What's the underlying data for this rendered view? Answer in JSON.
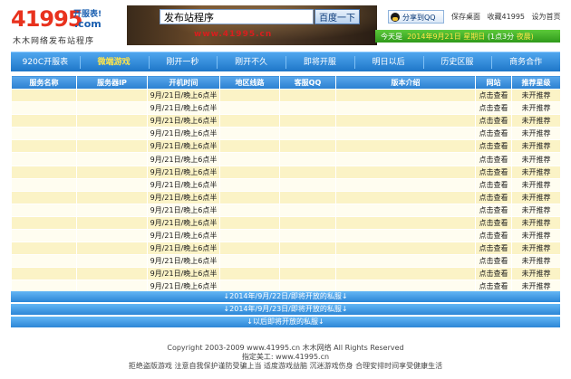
{
  "logo": {
    "number": "41995",
    "domain": ".com",
    "badge": "开服表!",
    "subtitle": "木木网络发布站程序"
  },
  "search": {
    "value": "发布站程序",
    "button": "百度一下",
    "banner_url": "www.41995.cn"
  },
  "top_bar": {
    "share_label": "分享到QQ",
    "links": [
      "保存桌面",
      "收藏41995",
      "设为首页"
    ]
  },
  "date_bar": {
    "prefix": "今天是",
    "date": "2014年9月21日",
    "weekday": "星期日",
    "lunar": "(1点3分",
    "status": "夜晨)"
  },
  "nav": {
    "tabs": [
      {
        "label": "920C开服表",
        "active": false
      },
      {
        "label": "微端游戏",
        "active": true
      },
      {
        "label": "刚开一秒",
        "active": false
      },
      {
        "label": "刚开不久",
        "active": false
      },
      {
        "label": "即将开服",
        "active": false
      },
      {
        "label": "明日以后",
        "active": false
      },
      {
        "label": "历史区服",
        "active": false
      },
      {
        "label": "商务合作",
        "active": false
      }
    ]
  },
  "table": {
    "headers": [
      "服务名称",
      "服务器IP",
      "开机时间",
      "地区线路",
      "客服QQ",
      "版本介绍",
      "网站",
      "推荐星级"
    ],
    "rows": [
      {
        "name": "",
        "ip": "",
        "time": "9月/21日/晚上6点半",
        "region": "",
        "qq": "",
        "desc": "",
        "site": "点击查看",
        "pick": "未开推荐"
      },
      {
        "name": "",
        "ip": "",
        "time": "9月/21日/晚上6点半",
        "region": "",
        "qq": "",
        "desc": "",
        "site": "点击查看",
        "pick": "未开推荐"
      },
      {
        "name": "",
        "ip": "",
        "time": "9月/21日/晚上6点半",
        "region": "",
        "qq": "",
        "desc": "",
        "site": "点击查看",
        "pick": "未开推荐"
      },
      {
        "name": "",
        "ip": "",
        "time": "9月/21日/晚上6点半",
        "region": "",
        "qq": "",
        "desc": "",
        "site": "点击查看",
        "pick": "未开推荐"
      },
      {
        "name": "",
        "ip": "",
        "time": "9月/21日/晚上6点半",
        "region": "",
        "qq": "",
        "desc": "",
        "site": "点击查看",
        "pick": "未开推荐"
      },
      {
        "name": "",
        "ip": "",
        "time": "9月/21日/晚上6点半",
        "region": "",
        "qq": "",
        "desc": "",
        "site": "点击查看",
        "pick": "未开推荐"
      },
      {
        "name": "",
        "ip": "",
        "time": "9月/21日/晚上6点半",
        "region": "",
        "qq": "",
        "desc": "",
        "site": "点击查看",
        "pick": "未开推荐"
      },
      {
        "name": "",
        "ip": "",
        "time": "9月/21日/晚上6点半",
        "region": "",
        "qq": "",
        "desc": "",
        "site": "点击查看",
        "pick": "未开推荐"
      },
      {
        "name": "",
        "ip": "",
        "time": "9月/21日/晚上6点半",
        "region": "",
        "qq": "",
        "desc": "",
        "site": "点击查看",
        "pick": "未开推荐"
      },
      {
        "name": "",
        "ip": "",
        "time": "9月/21日/晚上6点半",
        "region": "",
        "qq": "",
        "desc": "",
        "site": "点击查看",
        "pick": "未开推荐"
      },
      {
        "name": "",
        "ip": "",
        "time": "9月/21日/晚上6点半",
        "region": "",
        "qq": "",
        "desc": "",
        "site": "点击查看",
        "pick": "未开推荐"
      },
      {
        "name": "",
        "ip": "",
        "time": "9月/21日/晚上6点半",
        "region": "",
        "qq": "",
        "desc": "",
        "site": "点击查看",
        "pick": "未开推荐"
      },
      {
        "name": "",
        "ip": "",
        "time": "9月/21日/晚上6点半",
        "region": "",
        "qq": "",
        "desc": "",
        "site": "点击查看",
        "pick": "未开推荐"
      },
      {
        "name": "",
        "ip": "",
        "time": "9月/21日/晚上6点半",
        "region": "",
        "qq": "",
        "desc": "",
        "site": "点击查看",
        "pick": "未开推荐"
      },
      {
        "name": "",
        "ip": "",
        "time": "9月/21日/晚上6点半",
        "region": "",
        "qq": "",
        "desc": "",
        "site": "点击查看",
        "pick": "未开推荐"
      },
      {
        "name": "",
        "ip": "",
        "time": "9月/21日/晚上6点半",
        "region": "",
        "qq": "",
        "desc": "",
        "site": "点击查看",
        "pick": "未开推荐"
      }
    ]
  },
  "expand_bars": [
    "↓2014年/9月/22日/即将开放的私服↓",
    "↓2014年/9月/23日/即将开放的私服↓",
    "↓以后即将开放的私服↓"
  ],
  "footer": {
    "copyright": "Copyright 2003-2009 www.41995.cn 木木网络 All Rights Reserved",
    "designer": "指定美工: www.41995.cn",
    "notice": "拒绝盗版游戏 注意自我保护谨防受骗上当 适度游戏益脑 沉迷游戏伤身 合理安排时间享受健康生活"
  },
  "colors": {
    "nav": "#2a7fd0",
    "active_tab": "#ffe44a",
    "row_yellow": "#fbf3c6",
    "date_bar": "#3aa821",
    "logo": "#e8321e"
  }
}
